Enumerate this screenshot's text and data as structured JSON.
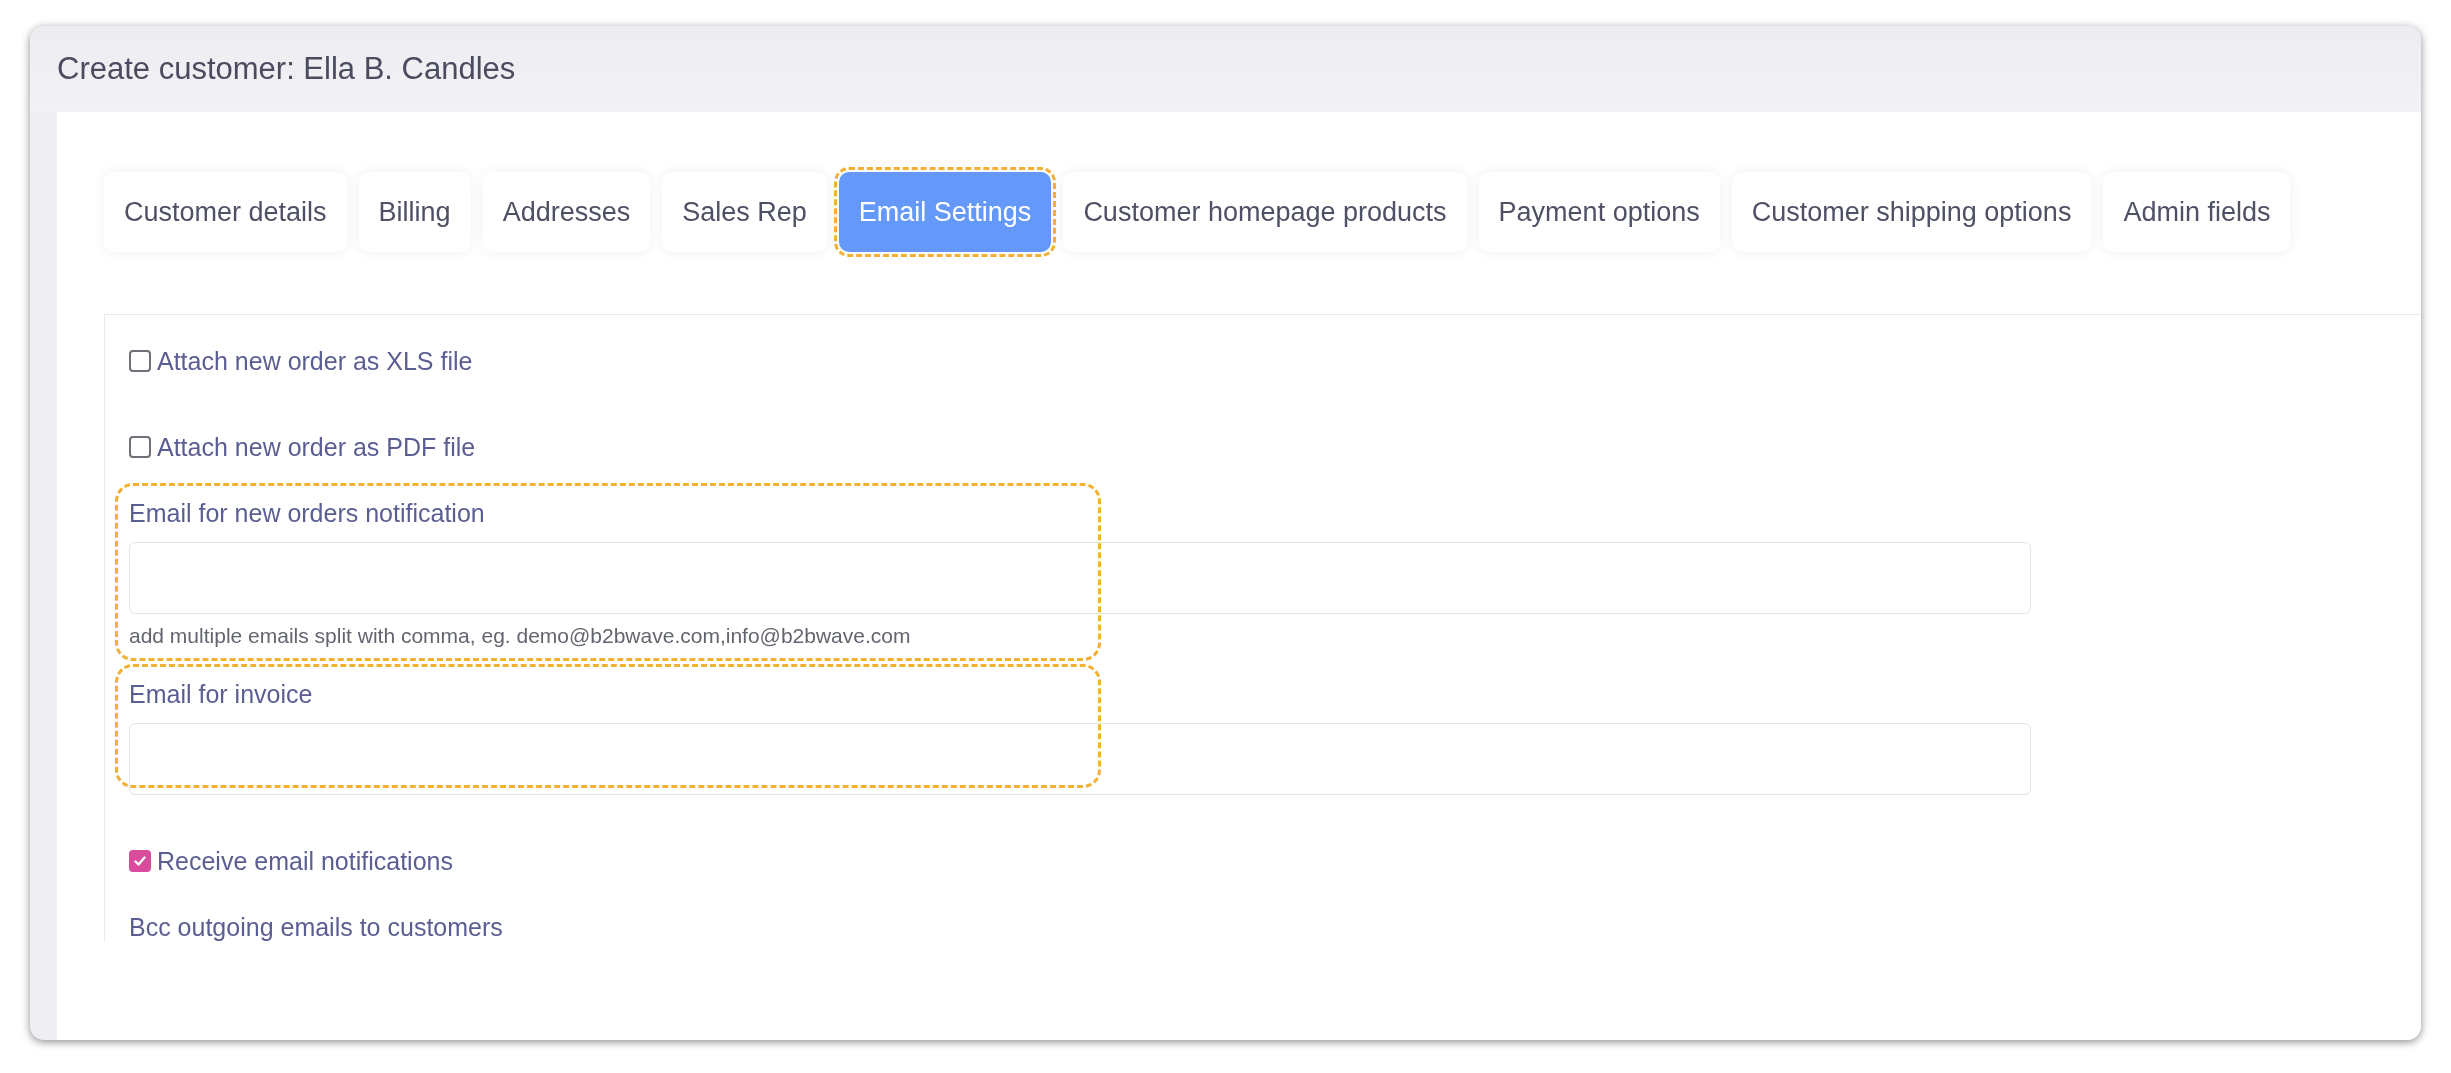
{
  "window": {
    "title": "Create customer: Ella B. Candles"
  },
  "tabs": [
    {
      "label": "Customer details",
      "selected": false,
      "highlighted": false
    },
    {
      "label": "Billing",
      "selected": false,
      "highlighted": false
    },
    {
      "label": "Addresses",
      "selected": false,
      "highlighted": false
    },
    {
      "label": "Sales Rep",
      "selected": false,
      "highlighted": false
    },
    {
      "label": "Email Settings",
      "selected": true,
      "highlighted": true
    },
    {
      "label": "Customer homepage products",
      "selected": false,
      "highlighted": false
    },
    {
      "label": "Payment options",
      "selected": false,
      "highlighted": false
    },
    {
      "label": "Customer shipping options",
      "selected": false,
      "highlighted": false
    },
    {
      "label": "Admin fields",
      "selected": false,
      "highlighted": false
    }
  ],
  "fields": [
    {
      "kind": "checkbox",
      "label": "Attach new order as XLS file",
      "checked": false
    },
    {
      "kind": "checkbox",
      "label": "Attach new order as PDF file",
      "checked": false
    },
    {
      "kind": "input",
      "label": "Email for new orders notification",
      "hint": "add multiple emails split with comma, eg. demo@b2bwave.com,info@b2bwave.com",
      "highlighted": true
    },
    {
      "kind": "input",
      "label": "Email for invoice",
      "highlighted": true
    },
    {
      "kind": "checkbox",
      "label": "Receive email notifications",
      "checked": true
    },
    {
      "kind": "label",
      "label": "Bcc outgoing emails to customers"
    }
  ]
}
